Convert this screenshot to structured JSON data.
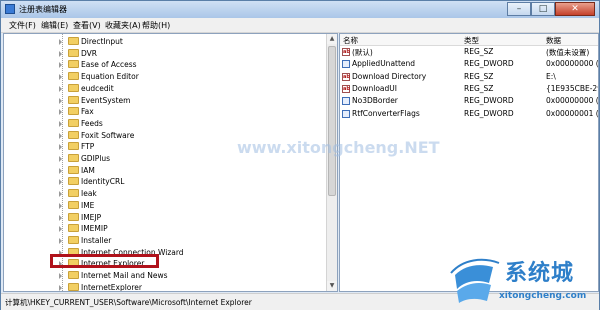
{
  "window": {
    "title": "注册表编辑器",
    "buttons": {
      "minimize": "–",
      "maximize": "□",
      "close": "✕"
    }
  },
  "menu": [
    "文件(F)",
    "编辑(E)",
    "查看(V)",
    "收藏夹(A)",
    "帮助(H)"
  ],
  "tree": {
    "items": [
      "DirectInput",
      "DVR",
      "Ease of Access",
      "Equation Editor",
      "eudcedit",
      "EventSystem",
      "Fax",
      "Feeds",
      "Foxit Software",
      "FTP",
      "GDIPlus",
      "IAM",
      "IdentityCRL",
      "Ieak",
      "IME",
      "IMEJP",
      "IMEMIP",
      "Installer",
      "Internet Connection Wizard",
      "Internet Explorer",
      "Internet Mail and News",
      "InternetExplorer"
    ],
    "selected": "Internet Explorer"
  },
  "values": {
    "columns": {
      "name": "名称",
      "type": "类型",
      "data": "数据"
    },
    "rows": [
      {
        "icon": "string-value-icon",
        "name": "(默认)",
        "type": "REG_SZ",
        "data": "(数值未设置)"
      },
      {
        "icon": "dword-value-icon",
        "name": "AppliedUnattend",
        "type": "REG_DWORD",
        "data": "0x00000000 (0"
      },
      {
        "icon": "string-value-icon",
        "name": "Download Directory",
        "type": "REG_SZ",
        "data": "E:\\"
      },
      {
        "icon": "string-value-icon",
        "name": "DownloadUI",
        "type": "REG_SZ",
        "data": "{1E935CBE-29"
      },
      {
        "icon": "dword-value-icon",
        "name": "No3DBorder",
        "type": "REG_DWORD",
        "data": "0x00000000 (0"
      },
      {
        "icon": "dword-value-icon",
        "name": "RtfConverterFlags",
        "type": "REG_DWORD",
        "data": "0x00000001 (1"
      }
    ]
  },
  "status": {
    "path": "计算机\\HKEY_CURRENT_USER\\Software\\Microsoft\\Internet Explorer"
  },
  "watermark": {
    "center_text": "www.xitongcheng.NET",
    "logo_title": "系统城",
    "logo_url": "xitongcheng.com"
  },
  "colors": {
    "highlight_border": "#b0121b",
    "logo_blue": "#2e7fc9"
  }
}
